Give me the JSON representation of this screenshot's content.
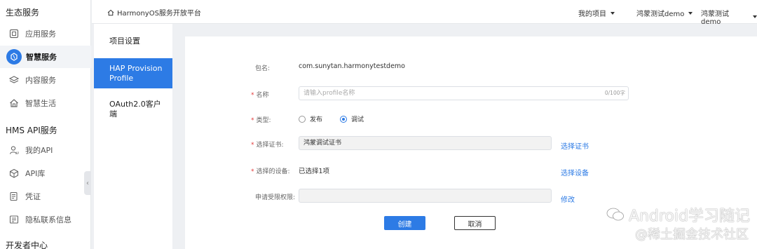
{
  "sidebar": {
    "section1": "生态服务",
    "items1": [
      {
        "label": "应用服务",
        "icon": "app-icon"
      },
      {
        "label": "智慧服务",
        "icon": "smart-service-icon"
      },
      {
        "label": "内容服务",
        "icon": "layers-icon"
      },
      {
        "label": "智慧生活",
        "icon": "home-icon"
      }
    ],
    "section2": "HMS API服务",
    "items2": [
      {
        "label": "我的API",
        "icon": "user-api-icon"
      },
      {
        "label": "API库",
        "icon": "cube-icon"
      },
      {
        "label": "凭证",
        "icon": "credential-icon"
      },
      {
        "label": "隐私联系信息",
        "icon": "privacy-icon"
      }
    ],
    "section3": "开发者中心"
  },
  "header": {
    "brand": "HarmonyOS服务开放平台",
    "menus": [
      "我的项目",
      "鸿蒙测试demo",
      "鸿蒙测试demo"
    ]
  },
  "tabs": [
    "项目设置",
    "HAP Provision Profile",
    "OAuth2.0客户端"
  ],
  "form": {
    "package_label": "包名:",
    "package_value": "com.sunytan.harmonytestdemo",
    "name_label": "名称",
    "name_placeholder": "请输入profile名称",
    "name_counter": "0/100字",
    "type_label": "类型:",
    "type_options": [
      "发布",
      "调试"
    ],
    "type_selected": "调试",
    "cert_label": "选择证书:",
    "cert_value": "鸿蒙调试证书",
    "cert_link": "选择证书",
    "device_label": "选择的设备:",
    "device_value": "已选择1项",
    "device_link": "选择设备",
    "perm_label": "申请受限权限:",
    "perm_value": "",
    "perm_link": "修改",
    "create_btn": "创建",
    "cancel_btn": "取消"
  },
  "watermark": {
    "line1": "Android学习随记",
    "line2": "@稀土掘金技术社区"
  },
  "colors": {
    "accent": "#2d7be5",
    "required": "#e23b3b"
  }
}
